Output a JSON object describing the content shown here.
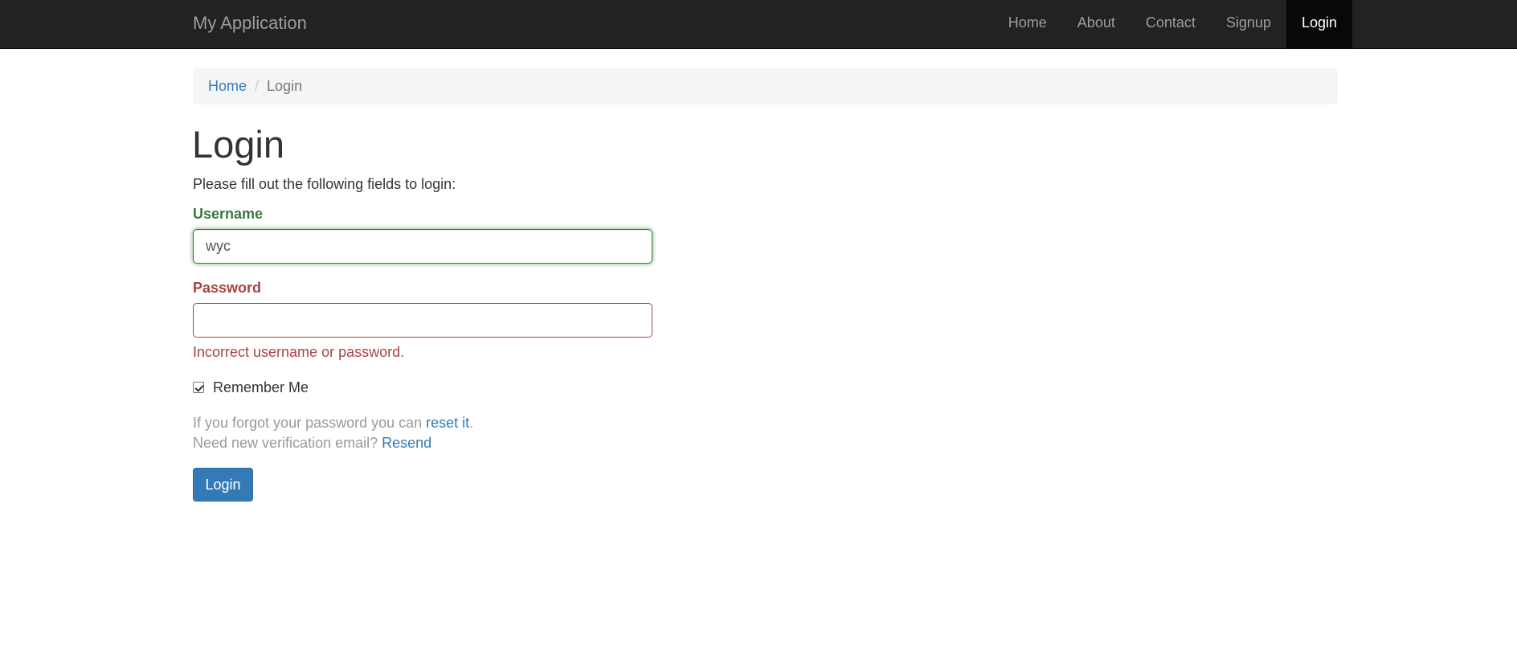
{
  "navbar": {
    "brand": "My Application",
    "items": [
      {
        "label": "Home"
      },
      {
        "label": "About"
      },
      {
        "label": "Contact"
      },
      {
        "label": "Signup"
      },
      {
        "label": "Login",
        "active": true
      }
    ]
  },
  "breadcrumb": {
    "home": "Home",
    "separator": "/",
    "current": "Login"
  },
  "page": {
    "title": "Login",
    "intro": "Please fill out the following fields to login:"
  },
  "form": {
    "username": {
      "label": "Username",
      "value": "wyc",
      "state": "valid"
    },
    "password": {
      "label": "Password",
      "value": "",
      "state": "error",
      "error": "Incorrect username or password."
    },
    "remember_me": {
      "label": "Remember Me",
      "checked": true
    },
    "forgot": {
      "prefix": "If you forgot your password you can ",
      "link": "reset it",
      "suffix": "."
    },
    "verification": {
      "prefix": "Need new verification email? ",
      "link": "Resend"
    },
    "submit_label": "Login"
  },
  "colors": {
    "navbar_bg": "#222222",
    "link": "#337ab7",
    "success": "#3c763d",
    "error": "#a94442",
    "primary_button": "#337ab7"
  }
}
